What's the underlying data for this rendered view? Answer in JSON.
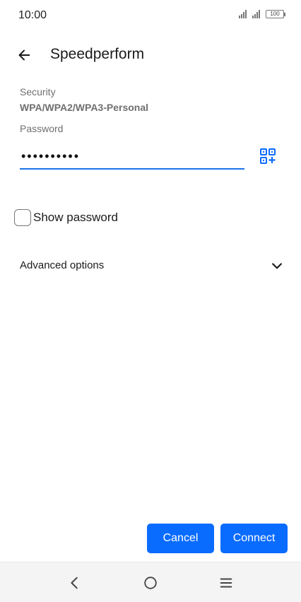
{
  "status_bar": {
    "time": "10:00",
    "battery": "100",
    "icons": [
      "signal-icon",
      "signal-icon",
      "battery-icon"
    ]
  },
  "header": {
    "title": "Speedperform",
    "back_icon": "arrow-left-icon"
  },
  "security": {
    "label": "Security",
    "value": "WPA/WPA2/WPA3-Personal"
  },
  "password": {
    "label": "Password",
    "value": "••••••••••",
    "qr_icon": "qr-scan-icon"
  },
  "show_password": {
    "label": "Show password",
    "checked": false
  },
  "advanced": {
    "label": "Advanced options",
    "icon": "chevron-down-icon"
  },
  "actions": {
    "cancel_label": "Cancel",
    "connect_label": "Connect"
  },
  "nav": {
    "icons": [
      "back-nav-icon",
      "home-nav-icon",
      "menu-nav-icon"
    ]
  },
  "colors": {
    "accent": "#0a6cff",
    "underline": "#1a73e8"
  }
}
